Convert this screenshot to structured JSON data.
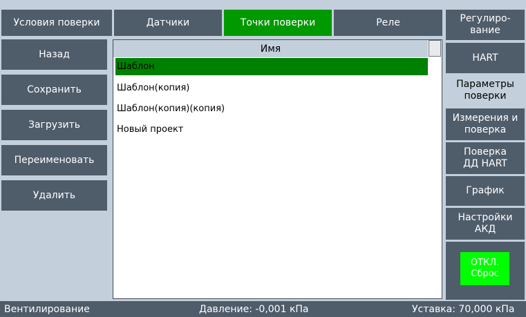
{
  "tabs": [
    {
      "label": "Условия поверки",
      "active": false
    },
    {
      "label": "Датчики",
      "active": false
    },
    {
      "label": "Точки поверки",
      "active": true
    },
    {
      "label": "Реле",
      "active": false
    }
  ],
  "left_buttons": [
    "Назад",
    "Сохранить",
    "Загрузить",
    "Переименовать",
    "Удалить"
  ],
  "list": {
    "header": "Имя",
    "items": [
      {
        "label": "Шаблон",
        "selected": true
      },
      {
        "label": "Шаблон(копия)",
        "selected": false
      },
      {
        "label": "Шаблон(копия)(копия)",
        "selected": false
      },
      {
        "label": "Новый проект",
        "selected": false
      }
    ]
  },
  "right_buttons": [
    {
      "line1": "Регулиро-",
      "line2": "вание",
      "active": false
    },
    {
      "line1": "HART",
      "line2": "",
      "active": false
    },
    {
      "line1": "Параметры",
      "line2": "поверки",
      "active": true
    },
    {
      "line1": "Измерения и",
      "line2": "поверка",
      "active": false
    },
    {
      "line1": "Поверка",
      "line2": "ДД HART",
      "active": false
    },
    {
      "line1": "График",
      "line2": "",
      "active": false
    },
    {
      "line1": "Настройки",
      "line2": "АКД",
      "active": false
    }
  ],
  "reset_button": {
    "line1": "ОТКЛ.",
    "line2": "Сброс"
  },
  "status": {
    "mode": "Вентилирование",
    "pressure": "Давление: -0,001 кПа",
    "setpoint": "Уставка: 70,000 кПа"
  },
  "colors": {
    "background": "#c3d0dc",
    "button": "#4f5c6a",
    "active_tab": "#009900",
    "selected_row": "#008000",
    "reset_button": "#00ff00"
  }
}
